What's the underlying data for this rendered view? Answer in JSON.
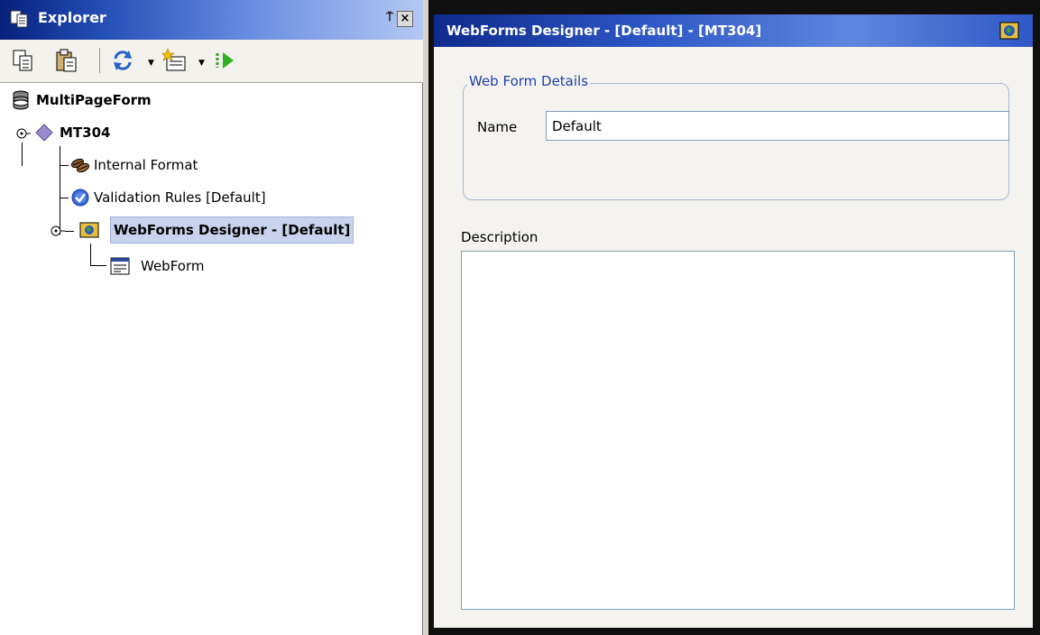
{
  "explorer": {
    "title": "Explorer",
    "pin_glyph": "⍑",
    "close_glyph": "×"
  },
  "toolbar": {
    "icons": [
      "copy-icon",
      "paste-icon",
      "refresh-icon",
      "new-item-icon",
      "run-icon"
    ]
  },
  "tree": {
    "root": "MultiPageForm",
    "message": "MT304",
    "children": [
      {
        "label": "Internal Format",
        "icon": "beans-icon"
      },
      {
        "label": "Validation Rules [Default]",
        "icon": "check-circle-icon"
      },
      {
        "label": "WebForms Designer - [Default]",
        "icon": "webforms-designer-icon"
      }
    ],
    "grandchild": "WebForm"
  },
  "designer": {
    "title": "WebForms Designer - [Default] - [MT304]",
    "details_legend": "Web Form Details",
    "name_label": "Name",
    "name_value": "Default",
    "description_label": "Description",
    "description_value": ""
  },
  "colors": {
    "title_bar": "#2450b8",
    "selection": "#c8d4ee",
    "legend_text": "#2040a8",
    "tree_diamond": "#9a8ad0"
  }
}
